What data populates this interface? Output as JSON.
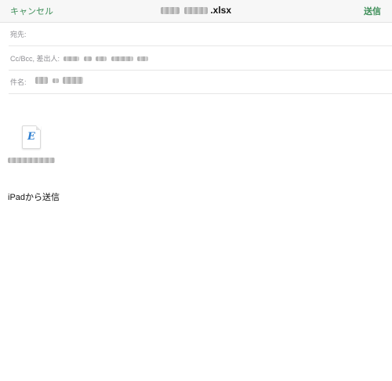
{
  "header": {
    "cancel_label": "キャンセル",
    "title_suffix": ".xlsx",
    "send_label": "送信"
  },
  "fields": {
    "to_label": "宛先:",
    "ccbcc_label": "Cc/Bcc, 差出人:",
    "subject_label": "件名:"
  },
  "attachment": {
    "icon": "excel-document-icon",
    "letter": "E"
  },
  "body": {
    "signature": "iPadから送信"
  },
  "colors": {
    "accent": "#3f8f5a",
    "label": "#8e8e93",
    "separator": "#e6e6e6",
    "toolbar_bg": "#f7f7f7",
    "doc_letter": "#2f7fd0"
  }
}
